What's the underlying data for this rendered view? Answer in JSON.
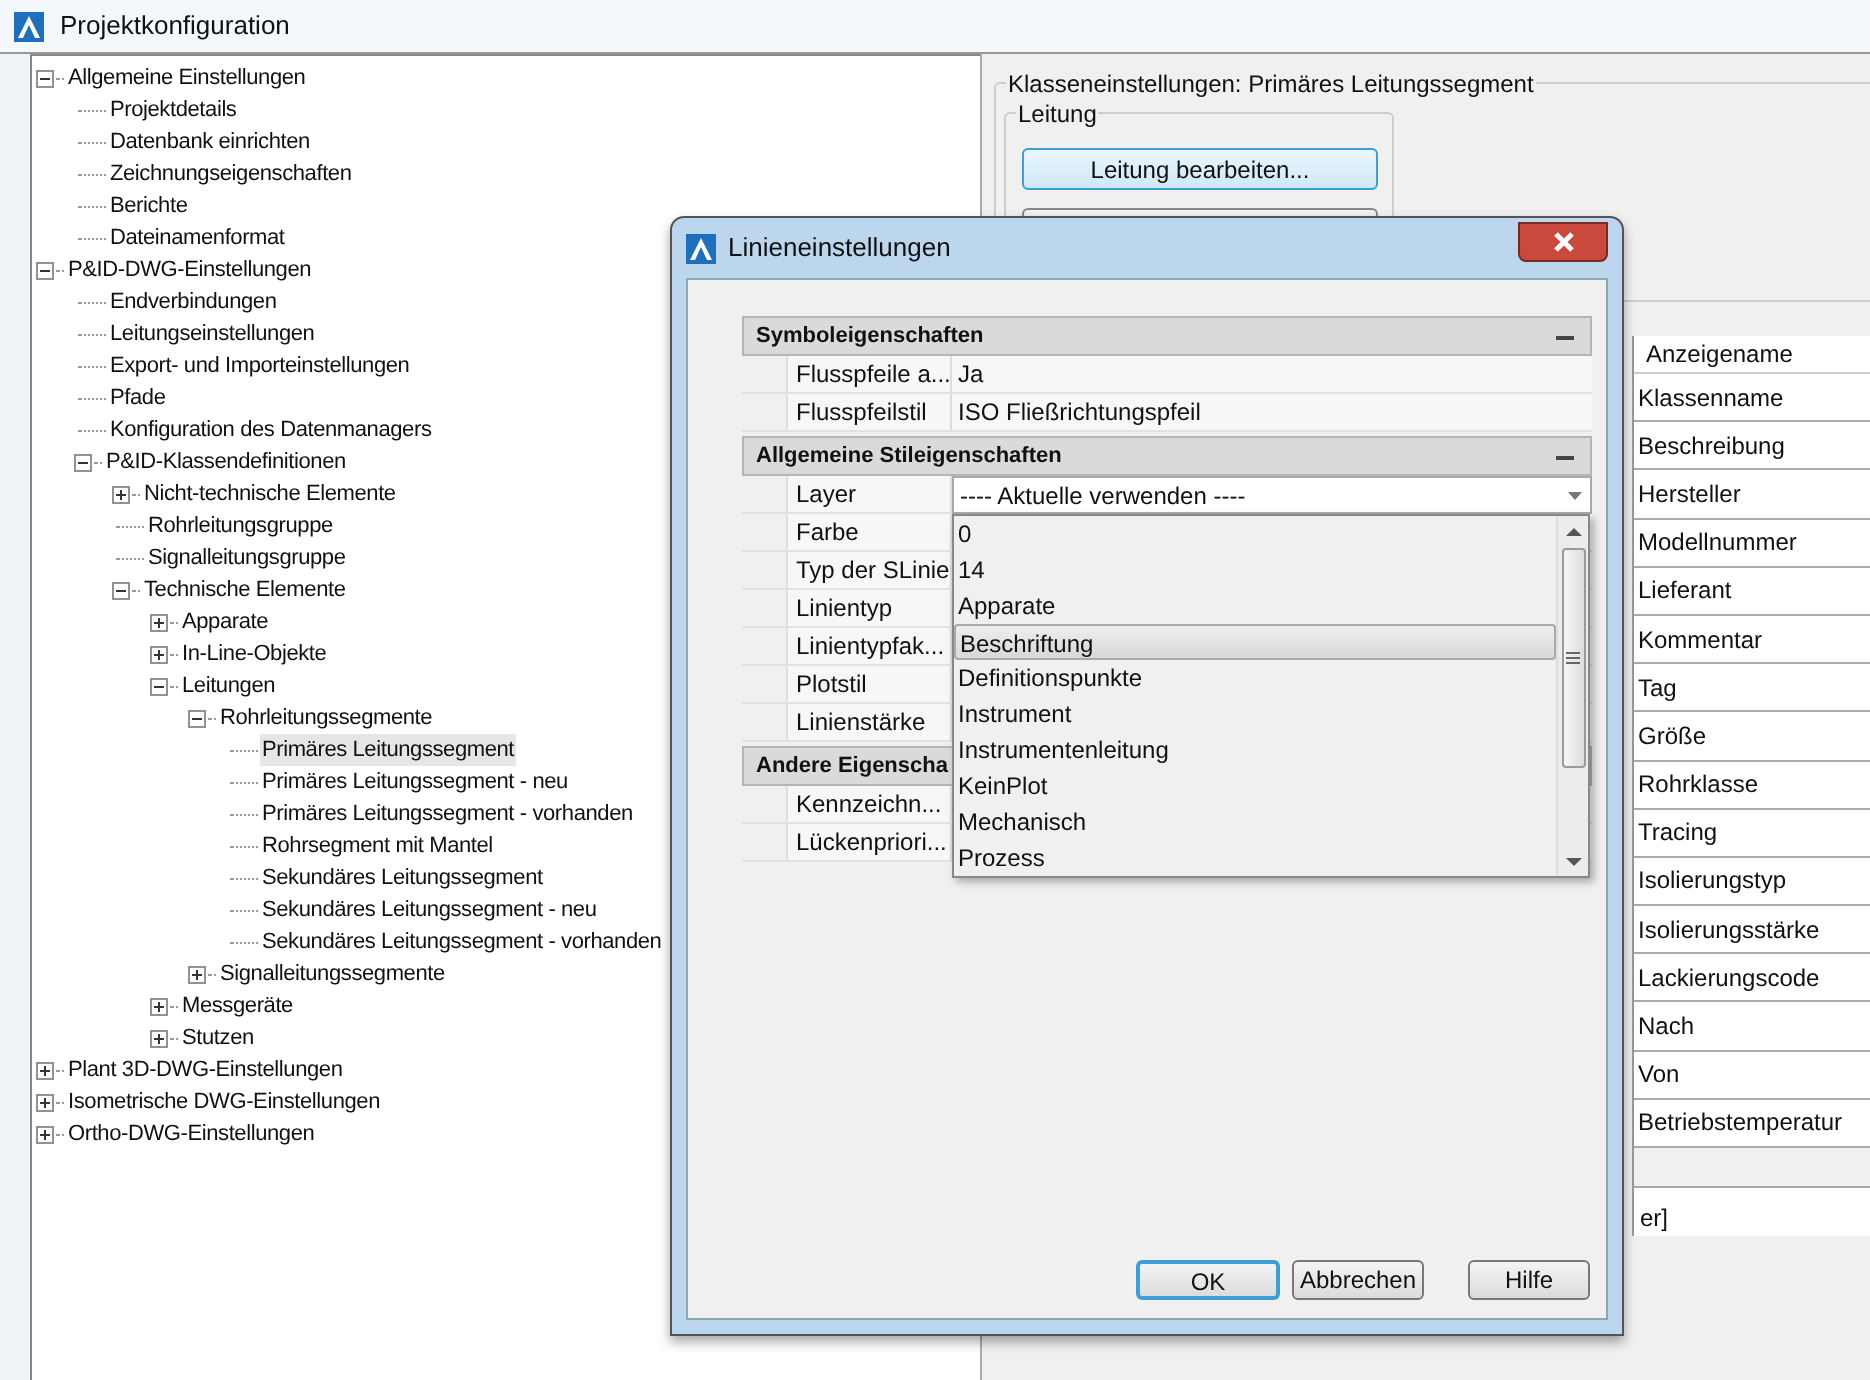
{
  "window": {
    "title": "Projektkonfiguration"
  },
  "tree": [
    {
      "label": "Allgemeine Einstellungen",
      "expanded": true,
      "selected": false,
      "children": [
        {
          "label": "Projektdetails",
          "selected": false
        },
        {
          "label": "Datenbank einrichten",
          "selected": false
        },
        {
          "label": "Zeichnungseigenschaften",
          "selected": false
        },
        {
          "label": "Berichte",
          "selected": false
        },
        {
          "label": "Dateinamenformat",
          "selected": false
        }
      ]
    },
    {
      "label": "P&ID-DWG-Einstellungen",
      "expanded": true,
      "selected": false,
      "children": [
        {
          "label": "Endverbindungen",
          "selected": false
        },
        {
          "label": "Leitungseinstellungen",
          "selected": false
        },
        {
          "label": "Export- und Importeinstellungen",
          "selected": false
        },
        {
          "label": "Pfade",
          "selected": false
        },
        {
          "label": "Konfiguration des Datenmanagers",
          "selected": false
        },
        {
          "label": "P&ID-Klassendefinitionen",
          "expanded": true,
          "selected": false,
          "children": [
            {
              "label": "Nicht-technische Elemente",
              "expanded": false,
              "selected": false
            },
            {
              "label": "Rohrleitungsgruppe",
              "selected": false
            },
            {
              "label": "Signalleitungsgruppe",
              "selected": false
            },
            {
              "label": "Technische Elemente",
              "expanded": true,
              "selected": false,
              "children": [
                {
                  "label": "Apparate",
                  "expanded": false,
                  "selected": false
                },
                {
                  "label": "In-Line-Objekte",
                  "expanded": false,
                  "selected": false
                },
                {
                  "label": "Leitungen",
                  "expanded": true,
                  "selected": false,
                  "children": [
                    {
                      "label": "Rohrleitungssegmente",
                      "expanded": true,
                      "selected": false,
                      "children": [
                        {
                          "label": "Primäres Leitungssegment",
                          "selected": true
                        },
                        {
                          "label": "Primäres Leitungssegment - neu",
                          "selected": false
                        },
                        {
                          "label": "Primäres Leitungssegment - vorhanden",
                          "selected": false
                        },
                        {
                          "label": "Rohrsegment mit Mantel",
                          "selected": false
                        },
                        {
                          "label": "Sekundäres Leitungssegment",
                          "selected": false
                        },
                        {
                          "label": "Sekundäres Leitungssegment - neu",
                          "selected": false
                        },
                        {
                          "label": "Sekundäres Leitungssegment - vorhanden",
                          "selected": false
                        }
                      ]
                    },
                    {
                      "label": "Signalleitungssegmente",
                      "expanded": false,
                      "selected": false
                    }
                  ]
                },
                {
                  "label": "Messgeräte",
                  "expanded": false,
                  "selected": false
                },
                {
                  "label": "Stutzen",
                  "expanded": false,
                  "selected": false
                }
              ]
            }
          ]
        }
      ]
    },
    {
      "label": "Plant 3D-DWG-Einstellungen",
      "expanded": false,
      "selected": false
    },
    {
      "label": "Isometrische DWG-Einstellungen",
      "expanded": false,
      "selected": false
    },
    {
      "label": "Ortho-DWG-Einstellungen",
      "expanded": false,
      "selected": false
    }
  ],
  "right_panel": {
    "group_title": "Klasseneinstellungen: Primäres Leitungssegment",
    "subgroup": {
      "title": "Leitung",
      "button": "Leitung bearbeiten..."
    },
    "table": {
      "header": "Anzeigename",
      "rows": [
        "Klassenname",
        "Beschreibung",
        "Hersteller",
        "Modellnummer",
        "Lieferant",
        "Kommentar",
        "Tag",
        "Größe",
        "Rohrklasse",
        "Tracing",
        "Isolierungstyp",
        "Isolierungsstärke",
        "Lackierungscode",
        "Nach",
        "Von",
        "Betriebstemperatur"
      ],
      "footer_text": "er]"
    }
  },
  "dialog": {
    "title": "Linieneinstellungen",
    "categories": [
      {
        "title": "Symboleigenschaften",
        "expanded": true,
        "properties": [
          {
            "name": "Flusspfeile a...",
            "value": "Ja"
          },
          {
            "name": "Flusspfeilstil",
            "value": "ISO Fließrichtungspfeil"
          }
        ]
      },
      {
        "title": "Allgemeine Stileigenschaften",
        "expanded": true,
        "properties": [
          {
            "name": "Layer",
            "value": "---- Aktuelle verwenden ----",
            "dropdown_open": true
          },
          {
            "name": "Farbe"
          },
          {
            "name": "Typ der SLinie"
          },
          {
            "name": "Linientyp"
          },
          {
            "name": "Linientypfak..."
          },
          {
            "name": "Plotstil"
          },
          {
            "name": "Linienstärke"
          }
        ]
      },
      {
        "title": "Andere Eigenscha",
        "properties": [
          {
            "name": "Kennzeichn..."
          },
          {
            "name": "Lückenpriori..."
          }
        ]
      }
    ],
    "dropdown": {
      "items": [
        {
          "label": "0",
          "selected": false
        },
        {
          "label": "14",
          "selected": false
        },
        {
          "label": "Apparate",
          "selected": false
        },
        {
          "label": "Beschriftung",
          "selected": true
        },
        {
          "label": "Definitionspunkte",
          "selected": false
        },
        {
          "label": "Instrument",
          "selected": false
        },
        {
          "label": "Instrumentenleitung",
          "selected": false
        },
        {
          "label": "KeinPlot",
          "selected": false
        },
        {
          "label": "Mechanisch",
          "selected": false
        },
        {
          "label": "Prozess",
          "selected": false
        }
      ]
    },
    "buttons": [
      {
        "label": "OK",
        "default": true
      },
      {
        "label": "Abbrechen",
        "default": false
      },
      {
        "label": "Hilfe",
        "default": false
      }
    ]
  }
}
